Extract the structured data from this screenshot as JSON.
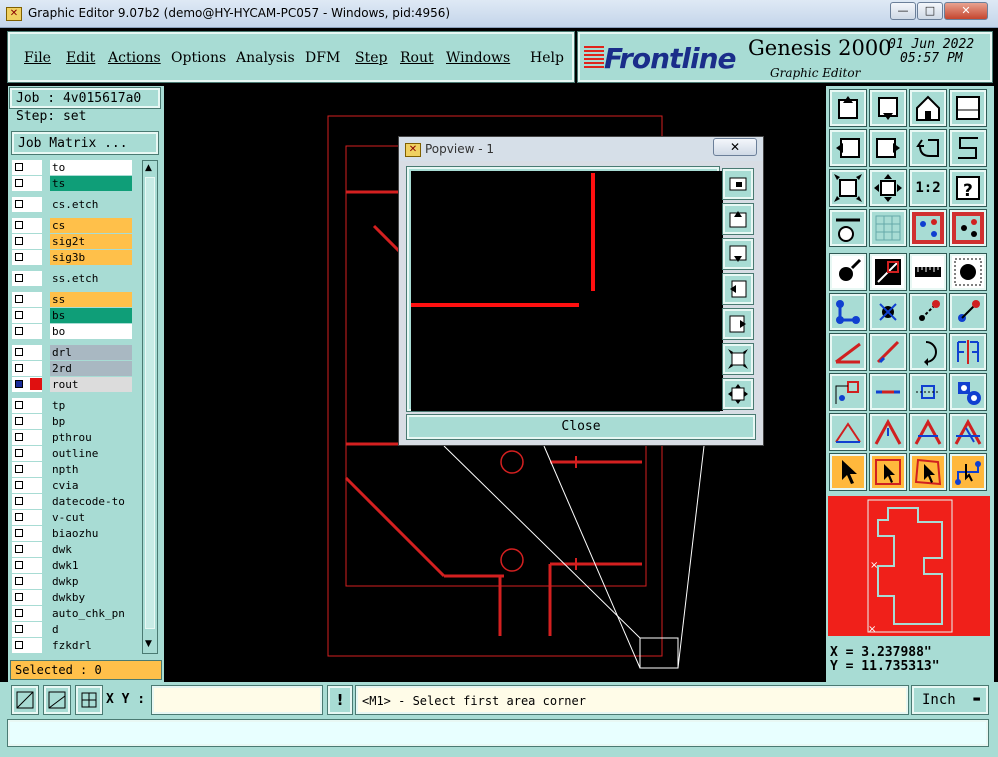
{
  "window": {
    "title": "Graphic Editor 9.07b2 (demo@HY-HYCAM-PC057 - Windows, pid:4956)",
    "min": "—",
    "max": "□",
    "close": "✕"
  },
  "menu": [
    {
      "label": "File"
    },
    {
      "label": "Edit"
    },
    {
      "label": "Actions"
    },
    {
      "label": "Options"
    },
    {
      "label": "Analysis"
    },
    {
      "label": "DFM"
    },
    {
      "label": "Step"
    },
    {
      "label": "Rout"
    },
    {
      "label": "Windows"
    },
    {
      "label": "Help"
    }
  ],
  "brand": {
    "logo": "Frontline",
    "product": "Genesis 2000",
    "subtitle": "Graphic Editor",
    "date": "01 Jun 2022",
    "time": "05:57 PM"
  },
  "job": {
    "job_label": "Job : 4v015617a0",
    "step_label": "Step: set",
    "matrix_button": "Job Matrix ..."
  },
  "layers": [
    {
      "name": "to",
      "color": "#ffffff"
    },
    {
      "name": "ts",
      "color": "#0f9e78"
    },
    {
      "name": "cs.etch",
      "color": "#a8dcd4"
    },
    {
      "name": "cs",
      "color": "#ffc04a"
    },
    {
      "name": "sig2t",
      "color": "#ffc04a"
    },
    {
      "name": "sig3b",
      "color": "#ffc04a"
    },
    {
      "name": "ss.etch",
      "color": "#a8dcd4"
    },
    {
      "name": "ss",
      "color": "#ffc04a"
    },
    {
      "name": "bs",
      "color": "#0f9e78"
    },
    {
      "name": "bo",
      "color": "#ffffff"
    },
    {
      "name": "drl",
      "color": "#a9b8c2"
    },
    {
      "name": "2rd",
      "color": "#a9b8c2"
    },
    {
      "name": "rout",
      "color": "#dcdcdc"
    },
    {
      "name": "tp",
      "color": "#a8dcd4"
    },
    {
      "name": "bp",
      "color": "#a8dcd4"
    },
    {
      "name": "pthrou",
      "color": "#a8dcd4"
    },
    {
      "name": "outline",
      "color": "#a8dcd4"
    },
    {
      "name": "npth",
      "color": "#a8dcd4"
    },
    {
      "name": "cvia",
      "color": "#a8dcd4"
    },
    {
      "name": "datecode-to",
      "color": "#a8dcd4"
    },
    {
      "name": "v-cut",
      "color": "#a8dcd4"
    },
    {
      "name": "biaozhu",
      "color": "#a8dcd4"
    },
    {
      "name": "dwk",
      "color": "#a8dcd4"
    },
    {
      "name": "dwk1",
      "color": "#a8dcd4"
    },
    {
      "name": "dwkp",
      "color": "#a8dcd4"
    },
    {
      "name": "dwkby",
      "color": "#a8dcd4"
    },
    {
      "name": "auto_chk_pn",
      "color": "#a8dcd4"
    },
    {
      "name": "d",
      "color": "#a8dcd4"
    },
    {
      "name": "fzkdrl",
      "color": "#a8dcd4"
    }
  ],
  "selected": "Selected : 0",
  "popup": {
    "title": "Popview - 1",
    "close_label": "Close",
    "close_x": "✕"
  },
  "coords": {
    "x": "X = 3.237988\"",
    "y": "Y = 11.735313\""
  },
  "bottom": {
    "xy_label": "X Y :",
    "xy_value": "",
    "message": "<M1> - Select first area corner",
    "unit": "Inch",
    "alert": "!"
  }
}
